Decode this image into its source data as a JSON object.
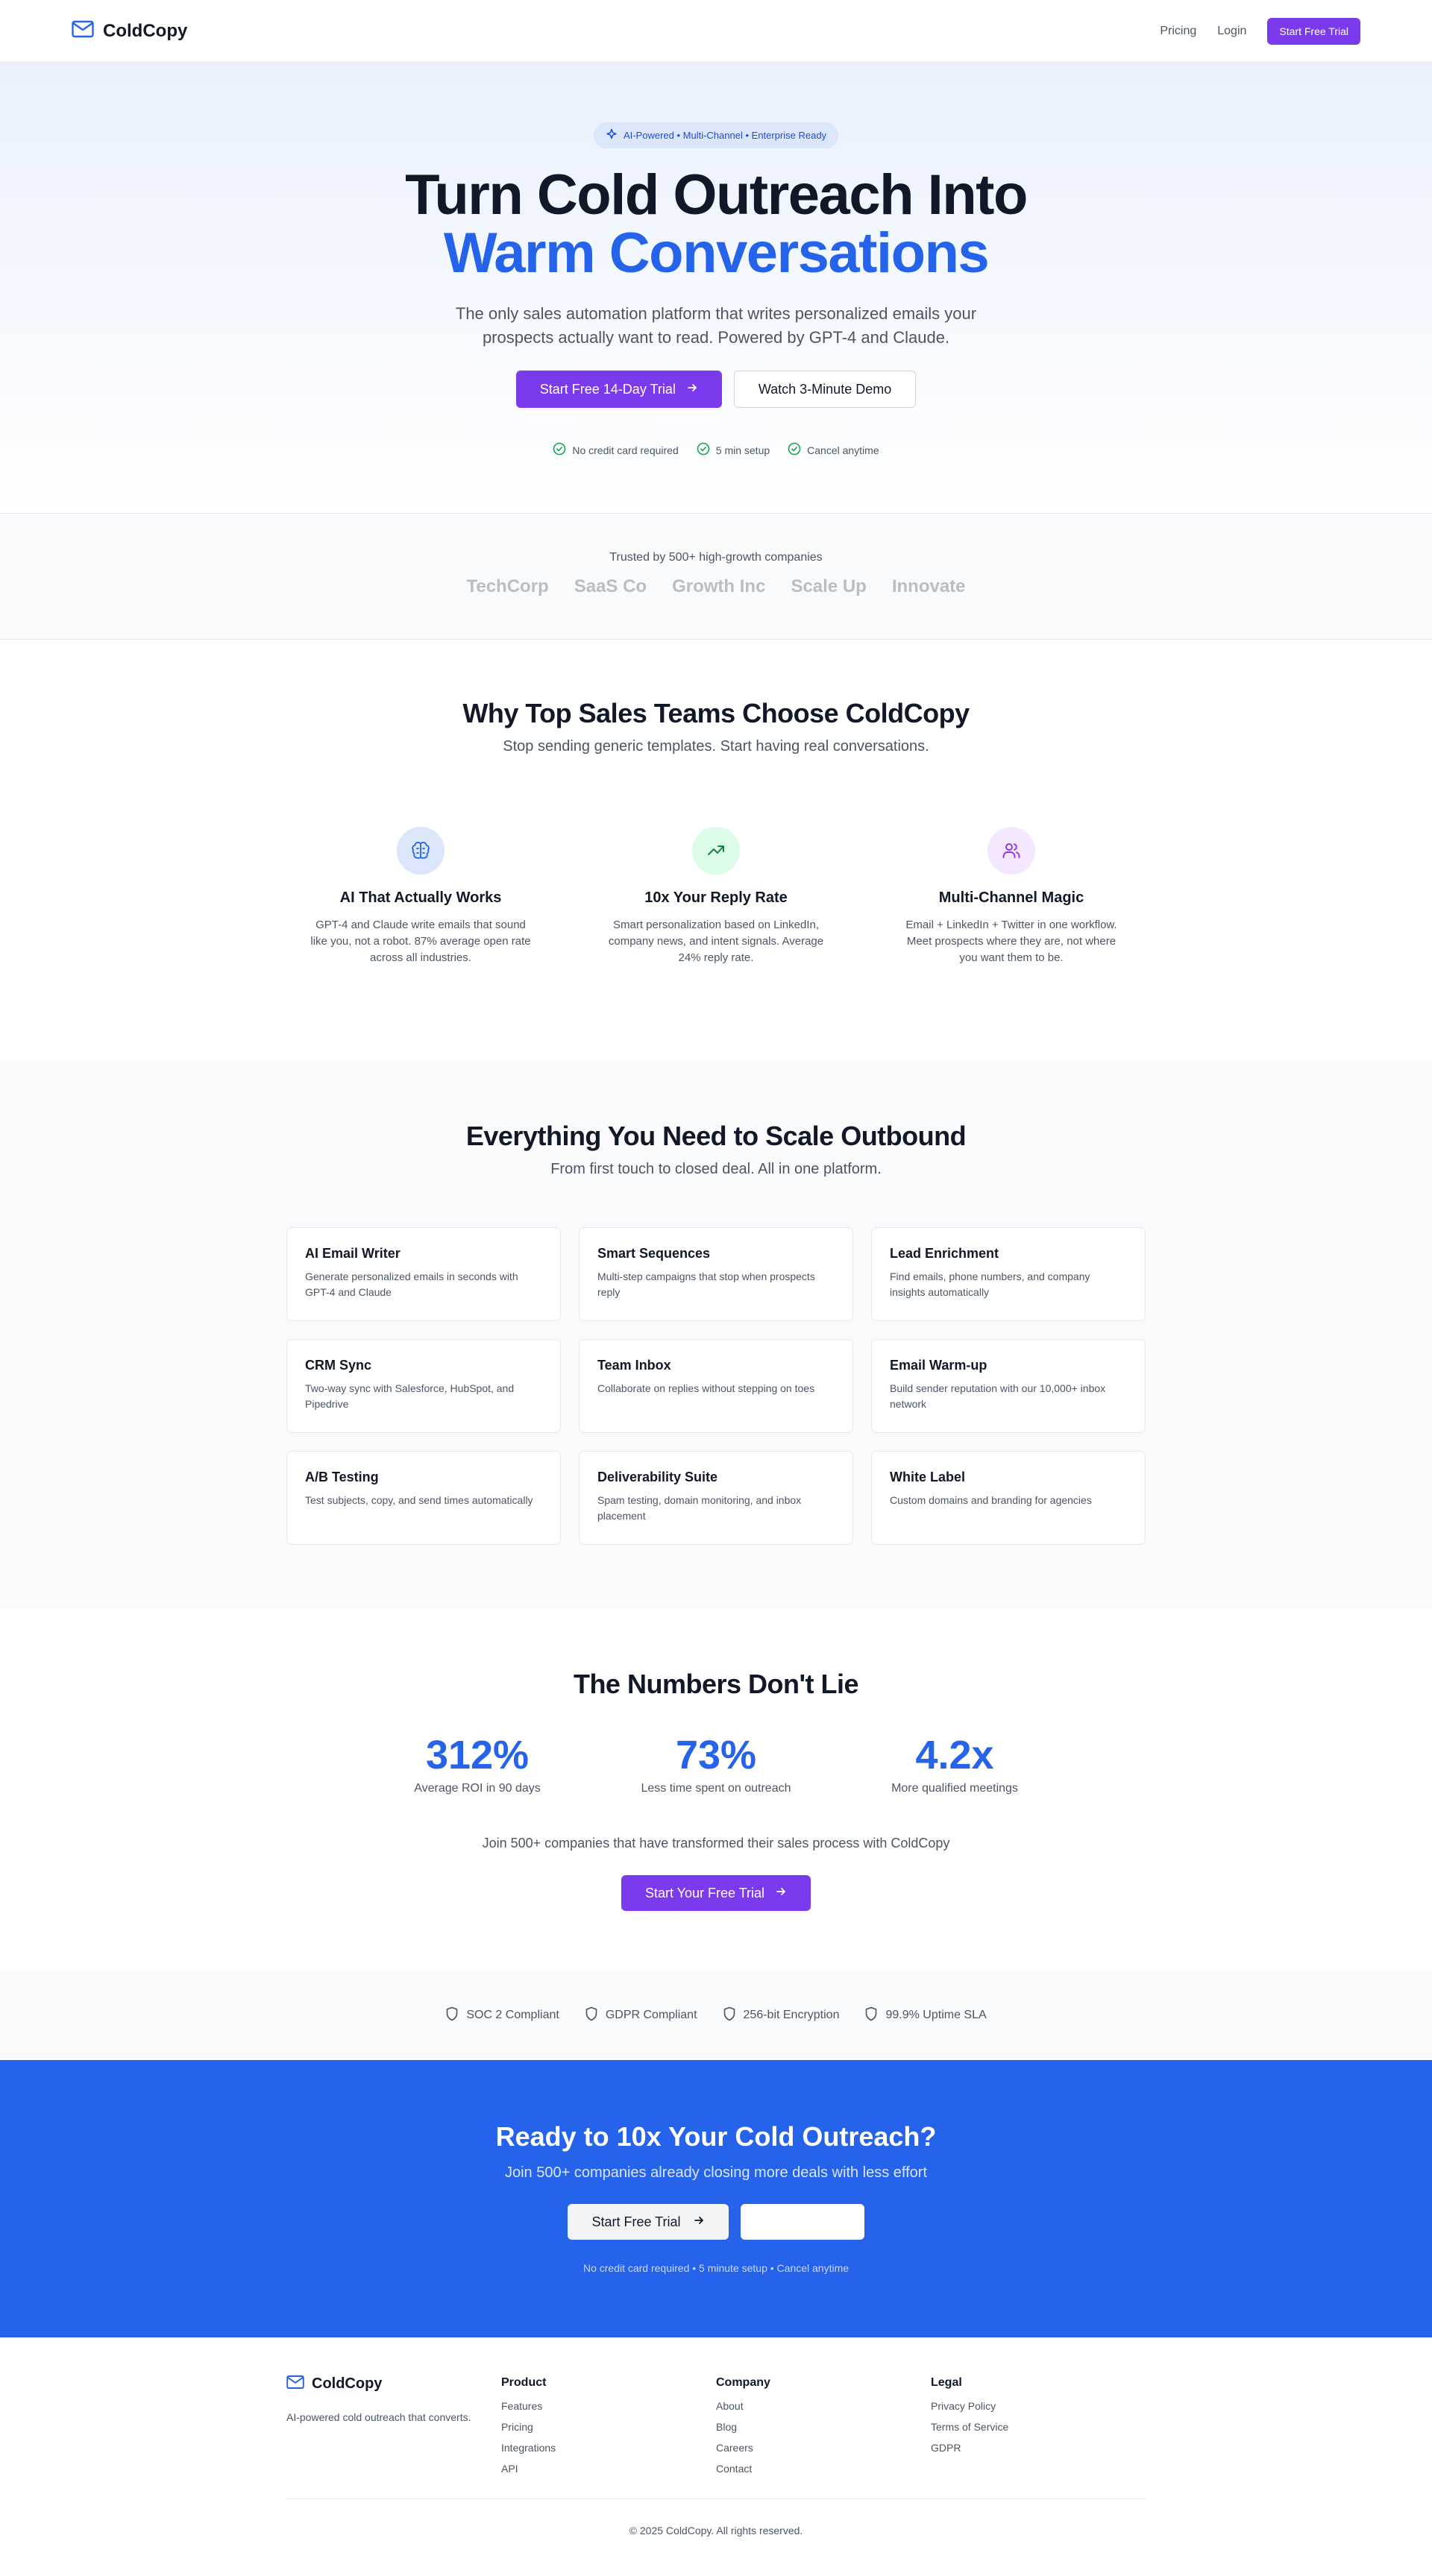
{
  "colors": {
    "primary_purple": "#7c3aed",
    "brand_blue": "#2563eb",
    "text_dark": "#111827",
    "text_muted": "#4b5563"
  },
  "nav": {
    "brand_name": "ColdCopy",
    "brand_icon": "mail-icon",
    "links": [
      "Pricing",
      "Login"
    ],
    "cta_label": "Start Free Trial"
  },
  "hero": {
    "badge": "AI-Powered • Multi-Channel • Enterprise Ready",
    "title_line1": "Turn Cold Outreach Into",
    "title_line2": "Warm Conversations",
    "subtitle": "The only sales automation platform that writes personalized emails your prospects actually want to read. Powered by GPT-4 and Claude.",
    "primary_cta": "Start Free 14-Day Trial",
    "secondary_cta": "Watch 3-Minute Demo",
    "checks": [
      "No credit card required",
      "5 min setup",
      "Cancel anytime"
    ]
  },
  "trusted": {
    "text": "Trusted by 500+ high-growth companies",
    "logos": [
      "TechCorp",
      "SaaS Co",
      "Growth Inc",
      "Scale Up",
      "Innovate"
    ]
  },
  "why": {
    "title": "Why Top Sales Teams Choose ColdCopy",
    "subtitle": "Stop sending generic templates. Start having real conversations.",
    "cards": [
      {
        "icon": "brain-icon",
        "title": "AI That Actually Works",
        "text": "GPT-4 and Claude write emails that sound like you, not a robot. 87% average open rate across all industries."
      },
      {
        "icon": "trending-up-icon",
        "title": "10x Your Reply Rate",
        "text": "Smart personalization based on LinkedIn, company news, and intent signals. Average 24% reply rate."
      },
      {
        "icon": "users-icon",
        "title": "Multi-Channel Magic",
        "text": "Email + LinkedIn + Twitter in one workflow. Meet prospects where they are, not where you want them to be."
      }
    ]
  },
  "features": {
    "title": "Everything You Need to Scale Outbound",
    "subtitle": "From first touch to closed deal. All in one platform.",
    "items": [
      {
        "title": "AI Email Writer",
        "text": "Generate personalized emails in seconds with GPT-4 and Claude"
      },
      {
        "title": "Smart Sequences",
        "text": "Multi-step campaigns that stop when prospects reply"
      },
      {
        "title": "Lead Enrichment",
        "text": "Find emails, phone numbers, and company insights automatically"
      },
      {
        "title": "CRM Sync",
        "text": "Two-way sync with Salesforce, HubSpot, and Pipedrive"
      },
      {
        "title": "Team Inbox",
        "text": "Collaborate on replies without stepping on toes"
      },
      {
        "title": "Email Warm-up",
        "text": "Build sender reputation with our 10,000+ inbox network"
      },
      {
        "title": "A/B Testing",
        "text": "Test subjects, copy, and send times automatically"
      },
      {
        "title": "Deliverability Suite",
        "text": "Spam testing, domain monitoring, and inbox placement"
      },
      {
        "title": "White Label",
        "text": "Custom domains and branding for agencies"
      }
    ]
  },
  "numbers": {
    "title": "The Numbers Don't Lie",
    "stats": [
      {
        "value": "312%",
        "label": "Average ROI in 90 days"
      },
      {
        "value": "73%",
        "label": "Less time spent on outreach"
      },
      {
        "value": "4.2x",
        "label": "More qualified meetings"
      }
    ],
    "join_text": "Join 500+ companies that have transformed their sales process with ColdCopy",
    "cta": "Start Your Free Trial"
  },
  "compliance": [
    "SOC 2 Compliant",
    "GDPR Compliant",
    "256-bit Encryption",
    "99.9% Uptime SLA"
  ],
  "cta": {
    "title": "Ready to 10x Your Cold Outreach?",
    "subtitle": "Join 500+ companies already closing more deals with less effort",
    "primary": "Start Free Trial",
    "note": "No credit card required • 5 minute setup • Cancel anytime"
  },
  "footer": {
    "brand_name": "ColdCopy",
    "tagline": "AI-powered cold outreach that converts.",
    "columns": [
      {
        "title": "Product",
        "links": [
          "Features",
          "Pricing",
          "Integrations",
          "API"
        ]
      },
      {
        "title": "Company",
        "links": [
          "About",
          "Blog",
          "Careers",
          "Contact"
        ]
      },
      {
        "title": "Legal",
        "links": [
          "Privacy Policy",
          "Terms of Service",
          "GDPR"
        ]
      }
    ],
    "copyright": "© 2025 ColdCopy. All rights reserved."
  }
}
